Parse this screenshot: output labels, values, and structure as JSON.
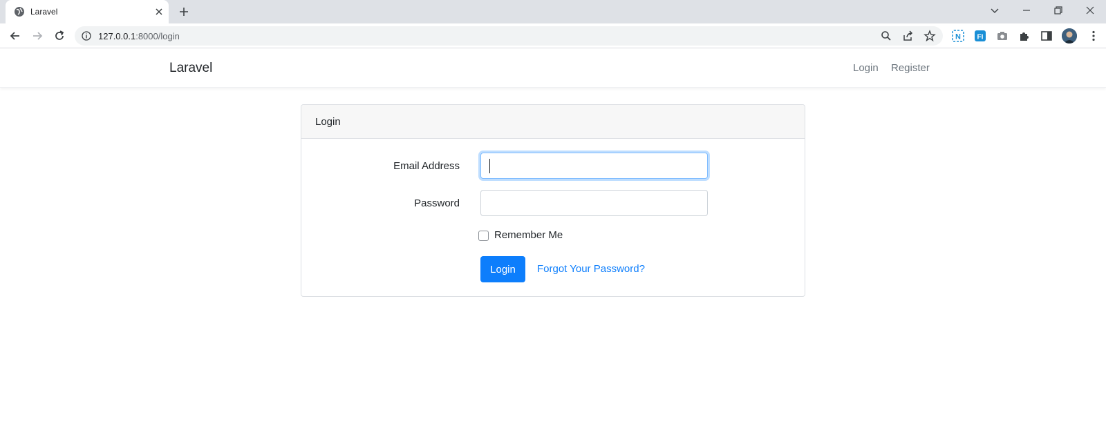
{
  "browser": {
    "tab_title": "Laravel",
    "url_host": "127.0.0.1",
    "url_rest": ":8000/login",
    "extension_icons": [
      "n-extension-icon",
      "fi-extension-icon",
      "camera-icon",
      "puzzle-icon",
      "sidepanel-icon"
    ]
  },
  "navbar": {
    "brand": "Laravel",
    "links": [
      "Login",
      "Register"
    ]
  },
  "card": {
    "title": "Login",
    "email_label": "Email Address",
    "email_value": "",
    "password_label": "Password",
    "password_value": "",
    "remember_label": "Remember Me",
    "login_button": "Login",
    "forgot_link": "Forgot Your Password?"
  },
  "colors": {
    "primary": "#0d7efc",
    "focus_border": "#80bdff",
    "tabstrip": "#dee1e6"
  }
}
